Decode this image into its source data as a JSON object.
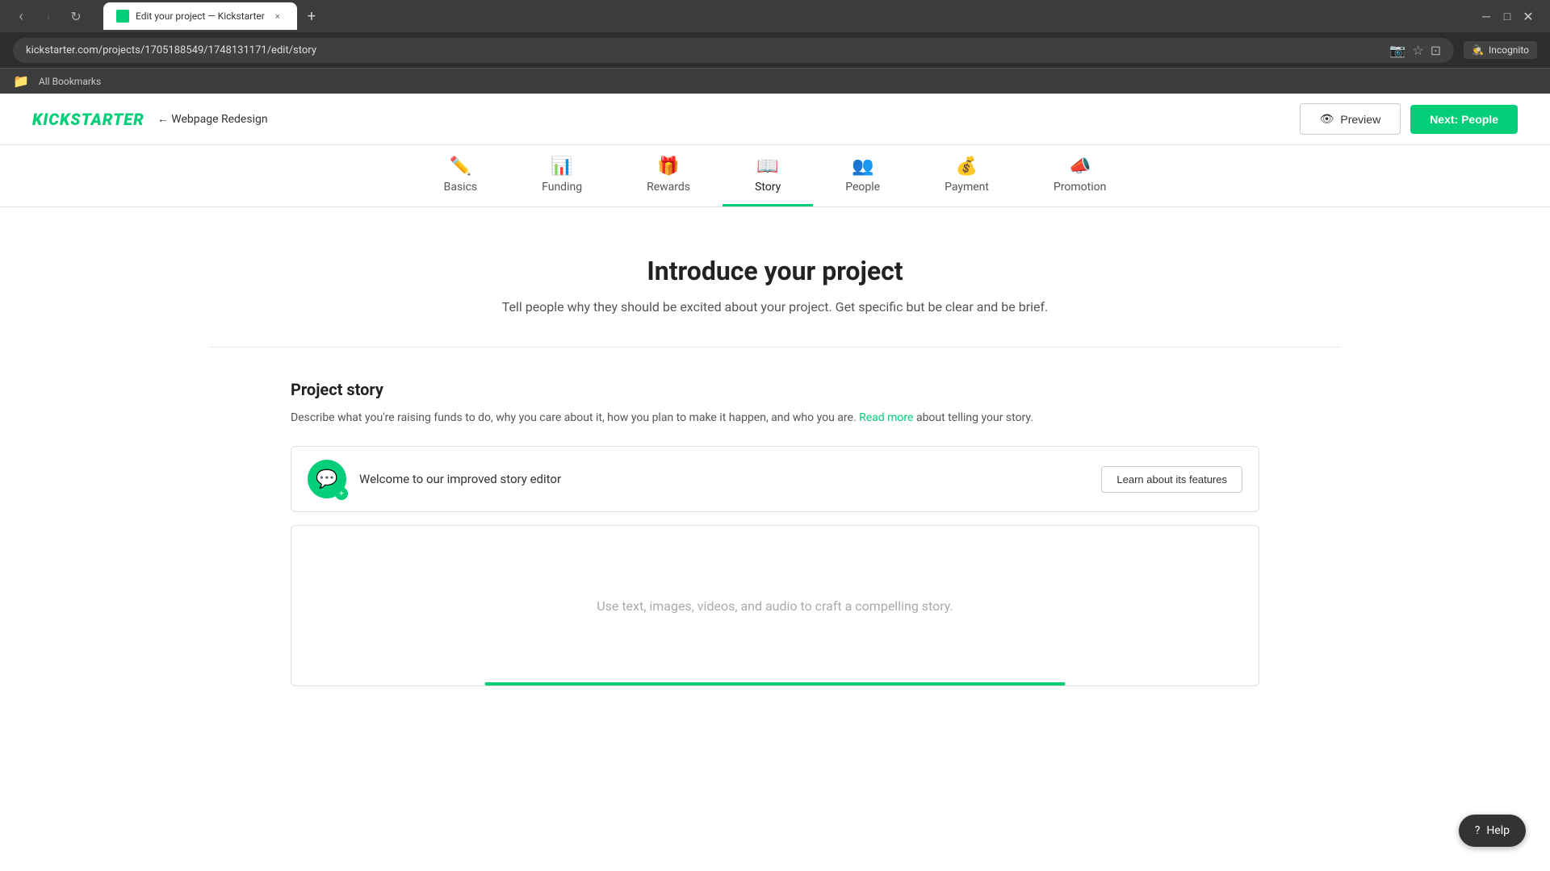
{
  "browser": {
    "tab_title": "Edit your project — Kickstarter",
    "url": "kickstarter.com/projects/1705188549/1748131171/edit/story",
    "incognito_label": "Incognito",
    "bookmarks_label": "All Bookmarks",
    "new_tab_label": "+"
  },
  "header": {
    "logo": "KICKSTARTER",
    "back_text": "← Webpage Redesign",
    "preview_label": "Preview",
    "next_label": "Next: People"
  },
  "nav": {
    "tabs": [
      {
        "id": "basics",
        "label": "Basics",
        "icon": "✏️",
        "active": false
      },
      {
        "id": "funding",
        "label": "Funding",
        "icon": "📊",
        "active": false
      },
      {
        "id": "rewards",
        "label": "Rewards",
        "icon": "🎁",
        "active": false
      },
      {
        "id": "story",
        "label": "Story",
        "icon": "📖",
        "active": true
      },
      {
        "id": "people",
        "label": "People",
        "icon": "👥",
        "active": false
      },
      {
        "id": "payment",
        "label": "Payment",
        "icon": "💰",
        "active": false
      },
      {
        "id": "promotion",
        "label": "Promotion",
        "icon": "📣",
        "active": false
      }
    ]
  },
  "page": {
    "title": "Introduce your project",
    "subtitle": "Tell people why they should be excited about your project. Get specific but be clear and be brief."
  },
  "story_section": {
    "title": "Project story",
    "description_start": "Describe what you're raising funds to do, why you care about it, how you plan to make it happen, and who you are.",
    "read_more_text": "Read more",
    "description_end": " about telling your story.",
    "banner": {
      "text": "Welcome to our improved story editor",
      "learn_btn": "Learn about its features"
    },
    "editor_placeholder": "Use text, images, videos, and audio to craft a compelling story."
  },
  "help": {
    "label": "Help"
  }
}
